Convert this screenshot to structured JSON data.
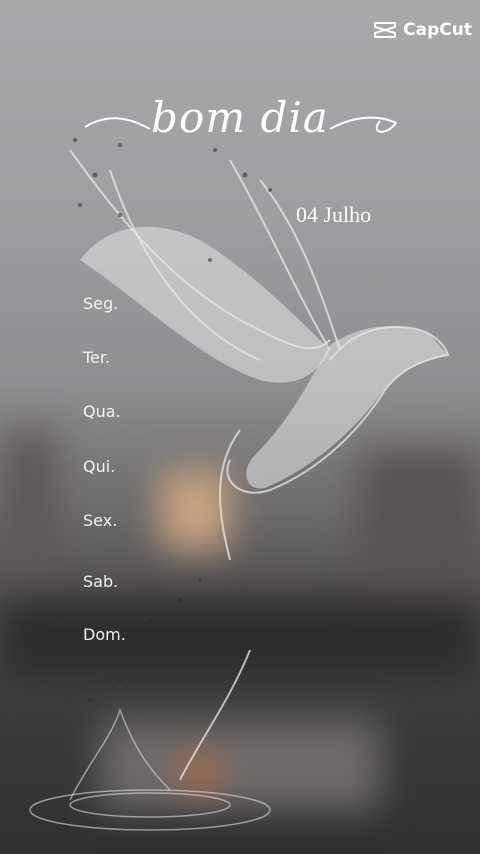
{
  "watermark": {
    "label": "CapCut",
    "icon": "capcut-logo-icon"
  },
  "greeting": "bom dia",
  "date": "04 Julho",
  "days": [
    "Seg.",
    "Ter.",
    "Qua.",
    "Qui.",
    "Sex.",
    "Sab.",
    "Dom."
  ],
  "colors": {
    "text": "#ffffff",
    "background_top": "#a9a8ab",
    "background_bottom": "#2f2f31"
  }
}
